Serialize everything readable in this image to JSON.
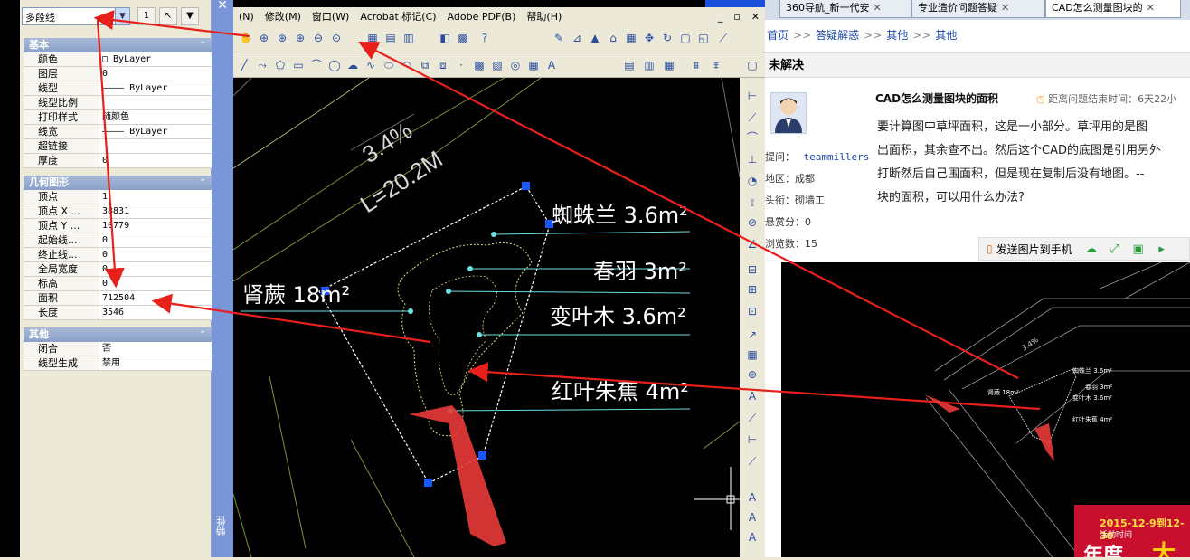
{
  "properties_panel": {
    "object_type": "多段线",
    "sections": [
      {
        "title": "基本",
        "rows": [
          {
            "name": "颜色",
            "value": "□ ByLayer"
          },
          {
            "name": "图层",
            "value": "0"
          },
          {
            "name": "线型",
            "value": "———— ByLayer"
          },
          {
            "name": "线型比例",
            "value": ""
          },
          {
            "name": "打印样式",
            "value": "随颜色"
          },
          {
            "name": "线宽",
            "value": "———— ByLayer"
          },
          {
            "name": "超链接",
            "value": ""
          },
          {
            "name": "厚度",
            "value": "0"
          }
        ]
      },
      {
        "title": "几何图形",
        "rows": [
          {
            "name": "顶点",
            "value": "1"
          },
          {
            "name": "顶点 X ...",
            "value": "38831"
          },
          {
            "name": "顶点 Y ...",
            "value": "10779"
          },
          {
            "name": "起始线...",
            "value": "0"
          },
          {
            "name": "终止线...",
            "value": "0"
          },
          {
            "name": "全局宽度",
            "value": "0"
          },
          {
            "name": "标高",
            "value": "0"
          },
          {
            "name": "面积",
            "value": "712504"
          },
          {
            "name": "长度",
            "value": "3546"
          }
        ]
      },
      {
        "title": "其他",
        "rows": [
          {
            "name": "闭合",
            "value": "否"
          },
          {
            "name": "线型生成",
            "value": "禁用"
          }
        ]
      }
    ],
    "palette_title": "特性",
    "close": "✕"
  },
  "cad": {
    "menu": [
      "(N)",
      "修改(M)",
      "窗口(W)",
      "Acrobat 标记(C)",
      "Adobe PDF(B)",
      "帮助(H)"
    ],
    "window_controls": [
      "_",
      "▫",
      "✕"
    ],
    "drawing": {
      "slope": "3.4%",
      "length": "L=20.2M",
      "labels": [
        "蜘蛛兰 3.6m²",
        "春羽 3m²",
        "变叶木 3.6m²",
        "红叶朱蕉 4m²",
        "肾蕨 18m²"
      ]
    }
  },
  "browser": {
    "tabs": [
      {
        "label": "360导航_新一代安",
        "active": false
      },
      {
        "label": "专业造价问题答疑",
        "active": false
      },
      {
        "label": "CAD怎么测量图块的",
        "active": true
      }
    ],
    "breadcrumb": [
      "首页",
      "答疑解惑",
      "其他",
      "其他"
    ],
    "status": "未解决",
    "user": {
      "name_label": "提问：",
      "name": "teammillers",
      "region": "地区：成都",
      "title": "头衔：砌墙工",
      "score": "悬赏分：0",
      "views": "浏览数：15"
    },
    "question": {
      "title": "CAD怎么测量图块的面积",
      "timer": "距离问题结束时间：6天22小",
      "body": "要计算图中草坪面积，这是一小部分。草坪用的是图\n出面积，其余查不出。然后这个CAD的底图是引用另外\n打断然后自己围面积，但是现在复制后没有地图。--\n块的面积，可以用什么办法?"
    },
    "share": {
      "send_label": "发送图片到手机"
    },
    "ad": {
      "date": "2015-12-9到12-30",
      "label": "活动时间",
      "big": "年度",
      "big2": "大"
    }
  }
}
